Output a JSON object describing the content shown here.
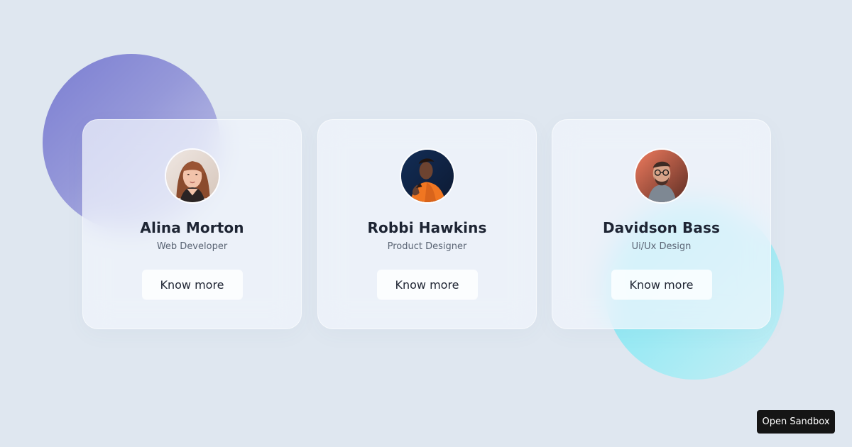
{
  "background": {
    "color": "#dfe7f0",
    "purple_blob": "#7b7ed2",
    "cyan_blob": "#7ee6f4"
  },
  "cards": [
    {
      "name": "Alina Morton",
      "role": "Web Developer",
      "button": "Know more",
      "avatar_icon": "woman-portrait-avatar"
    },
    {
      "name": "Robbi Hawkins",
      "role": "Product Designer",
      "button": "Know more",
      "avatar_icon": "man-portrait-avatar"
    },
    {
      "name": "Davidson Bass",
      "role": "Ui/Ux Design",
      "button": "Know more",
      "avatar_icon": "man-portrait-avatar"
    }
  ],
  "sandbox": {
    "label": "Open Sandbox"
  }
}
